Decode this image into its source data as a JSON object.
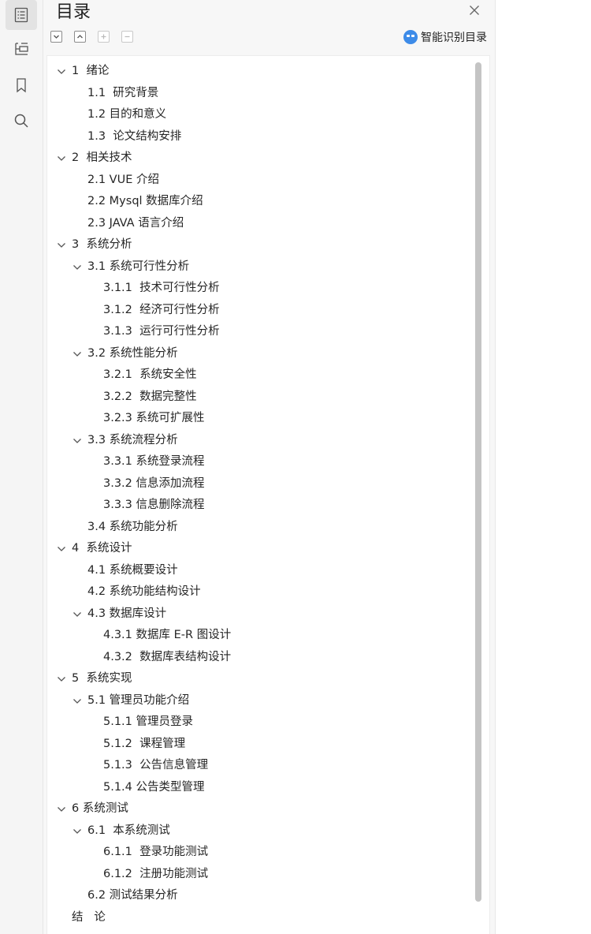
{
  "panel": {
    "title": "目录",
    "smart_toc_label": "智能识别目录"
  },
  "toolbar": {
    "expand_icon": "chevron-down-box-icon",
    "collapse_icon": "chevron-up-box-icon",
    "add_icon": "plus-box-icon",
    "remove_icon": "minus-box-icon"
  },
  "rail": {
    "items": [
      "toc-icon",
      "tree-icon",
      "bookmark-icon",
      "search-icon"
    ],
    "active": "toc-icon"
  },
  "toc": [
    {
      "level": 1,
      "expanded": true,
      "label": "1  绪论"
    },
    {
      "level": 2,
      "label": "1.1  研究背景"
    },
    {
      "level": 2,
      "label": "1.2 目的和意义"
    },
    {
      "level": 2,
      "label": "1.3  论文结构安排"
    },
    {
      "level": 1,
      "expanded": true,
      "label": "2  相关技术"
    },
    {
      "level": 2,
      "label": "2.1 VUE 介绍"
    },
    {
      "level": 2,
      "label": "2.2 Mysql 数据库介绍"
    },
    {
      "level": 2,
      "label": "2.3 JAVA 语言介绍"
    },
    {
      "level": 1,
      "expanded": true,
      "label": "3  系统分析"
    },
    {
      "level": 2,
      "expanded": true,
      "label": "3.1 系统可行性分析"
    },
    {
      "level": 3,
      "label": "3.1.1  技术可行性分析"
    },
    {
      "level": 3,
      "label": "3.1.2  经济可行性分析"
    },
    {
      "level": 3,
      "label": "3.1.3  运行可行性分析"
    },
    {
      "level": 2,
      "expanded": true,
      "label": "3.2 系统性能分析"
    },
    {
      "level": 3,
      "label": "3.2.1  系统安全性"
    },
    {
      "level": 3,
      "label": "3.2.2  数据完整性"
    },
    {
      "level": 3,
      "label": "3.2.3 系统可扩展性"
    },
    {
      "level": 2,
      "expanded": true,
      "label": "3.3 系统流程分析"
    },
    {
      "level": 3,
      "label": "3.3.1 系统登录流程"
    },
    {
      "level": 3,
      "label": "3.3.2 信息添加流程"
    },
    {
      "level": 3,
      "label": "3.3.3 信息删除流程"
    },
    {
      "level": 2,
      "label": "3.4 系统功能分析"
    },
    {
      "level": 1,
      "expanded": true,
      "label": "4  系统设计"
    },
    {
      "level": 2,
      "label": "4.1 系统概要设计"
    },
    {
      "level": 2,
      "label": "4.2 系统功能结构设计"
    },
    {
      "level": 2,
      "expanded": true,
      "label": "4.3 数据库设计"
    },
    {
      "level": 3,
      "label": "4.3.1 数据库 E-R 图设计"
    },
    {
      "level": 3,
      "label": "4.3.2  数据库表结构设计"
    },
    {
      "level": 1,
      "expanded": true,
      "label": "5  系统实现"
    },
    {
      "level": 2,
      "expanded": true,
      "label": "5.1 管理员功能介绍"
    },
    {
      "level": 3,
      "label": "5.1.1 管理员登录"
    },
    {
      "level": 3,
      "label": "5.1.2  课程管理"
    },
    {
      "level": 3,
      "label": "5.1.3  公告信息管理"
    },
    {
      "level": 3,
      "label": "5.1.4 公告类型管理"
    },
    {
      "level": 1,
      "expanded": true,
      "label": "6 系统测试"
    },
    {
      "level": 2,
      "expanded": true,
      "label": "6.1  本系统测试"
    },
    {
      "level": 3,
      "label": "6.1.1  登录功能测试"
    },
    {
      "level": 3,
      "label": "6.1.2  注册功能测试"
    },
    {
      "level": 2,
      "label": "6.2 测试结果分析"
    },
    {
      "level": 1,
      "label": "结   论"
    }
  ]
}
